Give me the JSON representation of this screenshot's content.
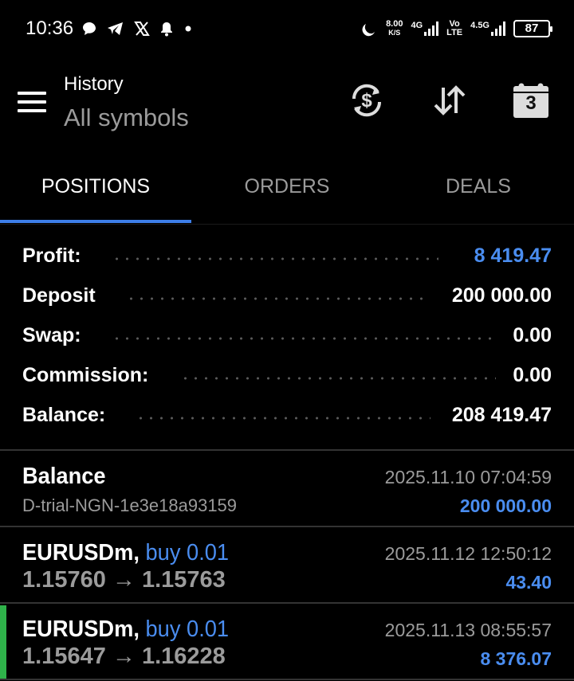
{
  "status_bar": {
    "time": "10:36",
    "speed_value": "8.00",
    "speed_unit": "K/S",
    "net1": "4G",
    "net2_top": "Vo",
    "net2_bottom": "LTE",
    "net3": "4.5G",
    "battery": "87"
  },
  "header": {
    "title": "History",
    "subtitle": "All symbols",
    "calendar_day": "3"
  },
  "tabs": [
    {
      "label": "POSITIONS",
      "active": true
    },
    {
      "label": "ORDERS",
      "active": false
    },
    {
      "label": "DEALS",
      "active": false
    }
  ],
  "summary": {
    "profit_label": "Profit:",
    "profit_value": "8 419.47",
    "deposit_label": "Deposit",
    "deposit_value": "200 000.00",
    "swap_label": "Swap:",
    "swap_value": "0.00",
    "commission_label": "Commission:",
    "commission_value": "0.00",
    "balance_label": "Balance:",
    "balance_value": "208 419.47"
  },
  "history": [
    {
      "title": "Balance",
      "subtitle": "D-trial-NGN-1e3e18a93159",
      "datetime": "2025.11.10 07:04:59",
      "amount": "200 000.00"
    },
    {
      "symbol": "EURUSDm,",
      "side": "buy 0.01",
      "prices": "1.15760 → 1.15763",
      "datetime": "2025.11.12 12:50:12",
      "amount": "43.40"
    },
    {
      "symbol": "EURUSDm,",
      "side": "buy 0.01",
      "prices": "1.15647 → 1.16228",
      "datetime": "2025.11.13 08:55:57",
      "amount": "8 376.07"
    }
  ],
  "colors": {
    "accent_blue": "#4a8df0",
    "tab_indicator": "#3d7ee8",
    "profit_green": "#2fb24a",
    "muted_text": "#9b9b9b"
  },
  "icons": {
    "status_left": [
      "speech-bubble-icon",
      "telegram-icon",
      "x-logo-icon",
      "bell-icon",
      "dot-icon"
    ],
    "status_right": [
      "moon-icon",
      "signal-icon",
      "battery-icon"
    ],
    "toolbar": [
      "menu-icon",
      "currency-sync-icon",
      "sort-icon",
      "calendar-icon"
    ]
  }
}
